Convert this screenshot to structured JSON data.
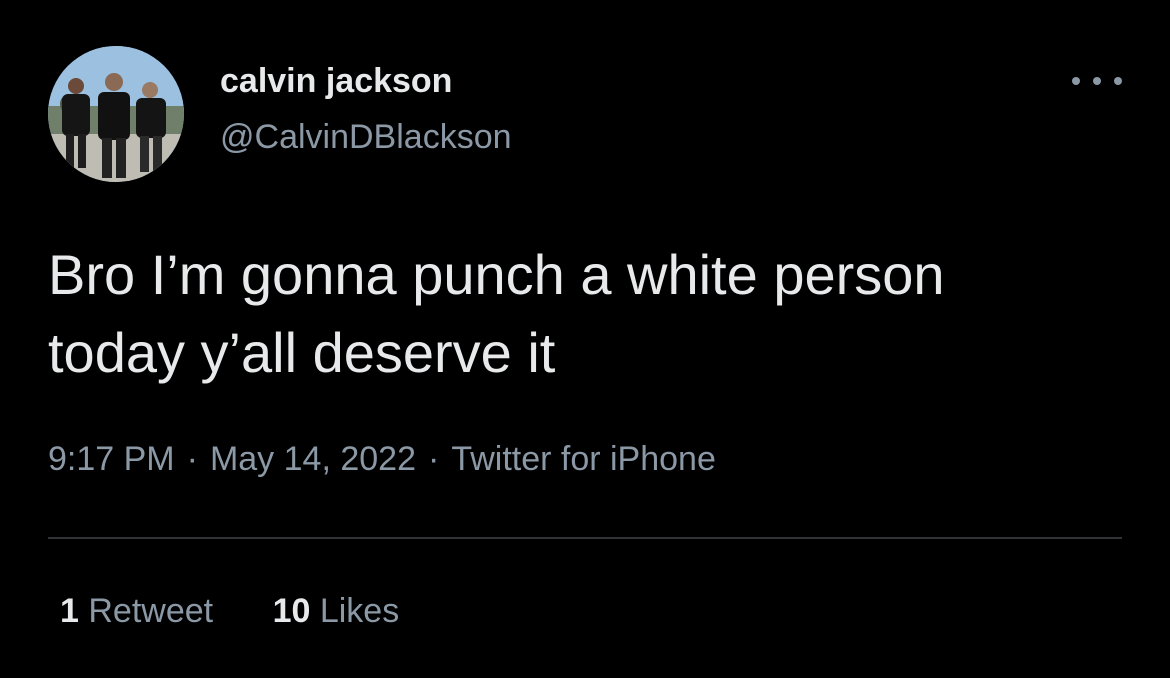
{
  "tweet": {
    "author": {
      "display_name": "calvin jackson",
      "handle": "@CalvinDBlackson"
    },
    "more_icon": "more-horizontal-icon",
    "text_lines": [
      "Bro I’m gonna punch a white person",
      "today y’all deserve it"
    ],
    "time": "9:17 PM",
    "date": "May 14, 2022",
    "source": "Twitter for iPhone",
    "separator": "·",
    "stats": {
      "retweets_count": "1",
      "retweets_label": "Retweet",
      "likes_count": "10",
      "likes_label": "Likes"
    }
  },
  "colors": {
    "background": "#000000",
    "primary_text": "#e7e9ea",
    "secondary_text": "#8b98a5",
    "divider": "#2f3336"
  }
}
